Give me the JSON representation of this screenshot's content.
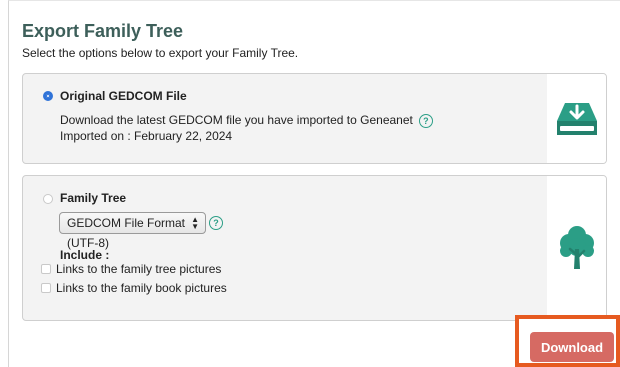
{
  "header": {
    "title": "Export Family Tree",
    "subtitle": "Select the options below to export your Family Tree."
  },
  "options": [
    {
      "label": "Original GEDCOM File",
      "selected": true,
      "description": "Download the latest GEDCOM file you have imported to Geneanet",
      "imported_on": "Imported on : February 22, 2024",
      "icon": "download-drive-icon"
    },
    {
      "label": "Family Tree",
      "selected": false,
      "format_select": {
        "value": "GEDCOM File Format (UTF-8)"
      },
      "include_label": "Include :",
      "checkboxes": [
        {
          "label": "Links to the family tree pictures",
          "checked": false
        },
        {
          "label": "Links to the family book pictures",
          "checked": false
        }
      ],
      "icon": "tree-icon"
    }
  ],
  "help_glyph": "?",
  "download_button": {
    "label": "Download"
  },
  "colors": {
    "title": "#3d5f5a",
    "accent_green": "#2b9e86",
    "radio_blue": "#2f73d8",
    "download_bg": "#d66a63",
    "highlight_frame": "#e65a20"
  }
}
